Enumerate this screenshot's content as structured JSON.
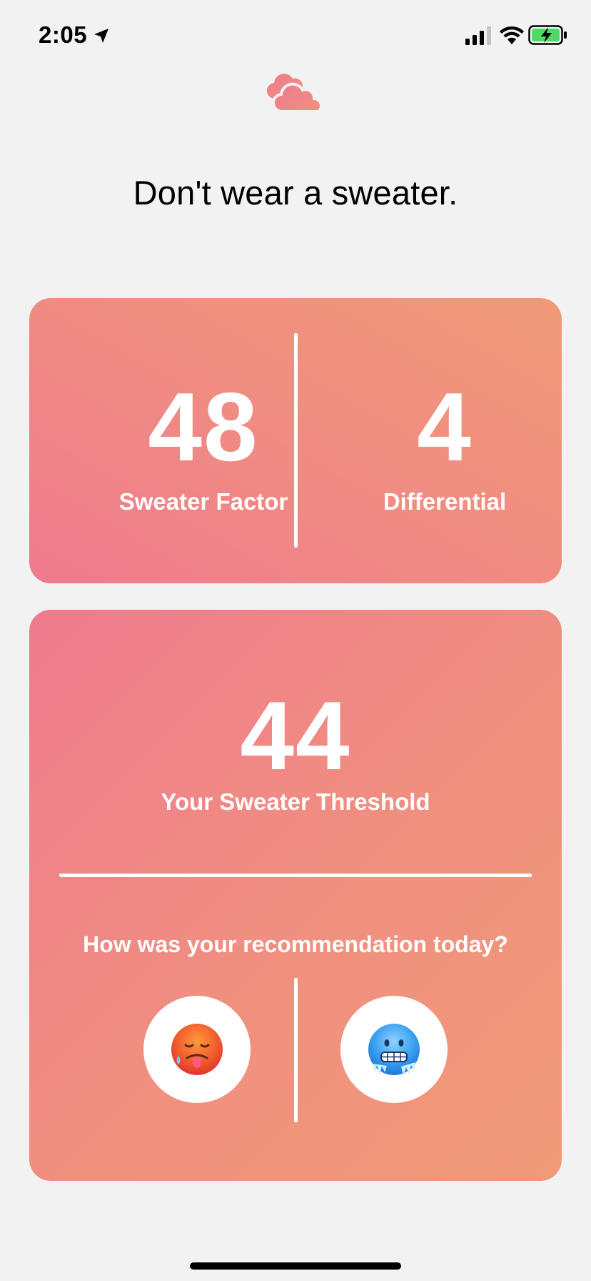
{
  "status_bar": {
    "time": "2:05",
    "icons": [
      "location-arrow-icon",
      "cellular-signal-icon",
      "wifi-icon",
      "battery-charging-icon"
    ]
  },
  "header": {
    "icon": "cloud-icon",
    "headline": "Don't wear a sweater."
  },
  "stats": {
    "sweater_factor": {
      "value": "48",
      "label": "Sweater Factor"
    },
    "differential": {
      "value": "4",
      "label": "Differential"
    }
  },
  "threshold": {
    "value": "44",
    "label": "Your Sweater Threshold"
  },
  "feedback": {
    "question": "How was your recommendation today?",
    "options": [
      {
        "icon": "hot-face-emoji-icon"
      },
      {
        "icon": "cold-face-emoji-icon"
      }
    ]
  },
  "colors": {
    "background": "#f2f2f2",
    "card_gradient_start": "#ef7a8e",
    "card_gradient_end": "#f09a78",
    "text_on_card": "#ffffff"
  }
}
